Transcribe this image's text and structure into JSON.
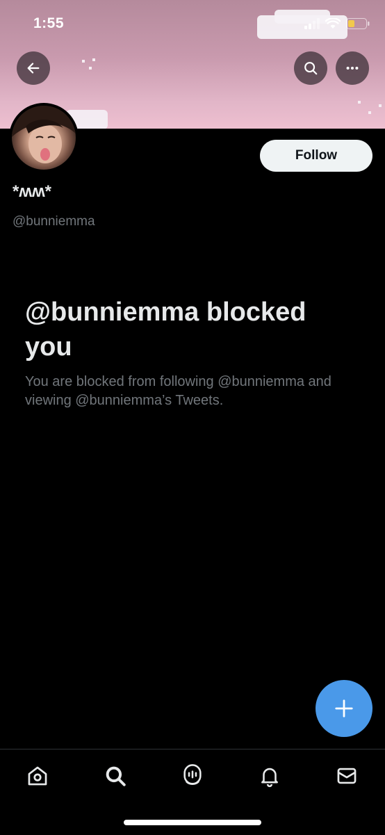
{
  "status_bar": {
    "time": "1:55"
  },
  "profile": {
    "display_name": "*ʍʍ*",
    "handle": "@bunniemma",
    "follow_label": "Follow"
  },
  "blocked": {
    "title": "@bunniemma blocked you",
    "description": "You are blocked from following @bunniemma and viewing @bunniemma’s Tweets."
  },
  "icons": {
    "back": "arrow-left-icon",
    "search": "search-icon",
    "more": "more-icon",
    "compose": "plus-icon",
    "tabs": [
      "home-icon",
      "search-icon",
      "spaces-icon",
      "notifications-icon",
      "messages-icon"
    ]
  },
  "colors": {
    "accent": "#4a99e9",
    "banner_pink": "#e2b6c8",
    "muted_text": "#71767b",
    "background": "#000000"
  }
}
